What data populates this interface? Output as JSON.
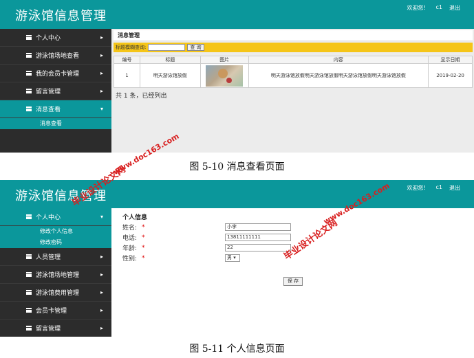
{
  "colors": {
    "teal": "#0b979b",
    "sidebar": "#2c2c2c",
    "search_bar": "#f5c518",
    "watermark": "#d81e1e"
  },
  "screen1": {
    "app_title": "游泳馆信息管理",
    "top_right": {
      "welcome": "欢迎您！",
      "user": "c1",
      "logout": "退出"
    },
    "sidebar": {
      "items": [
        {
          "label": "个人中心",
          "icon": "list-icon",
          "arrow": "▸"
        },
        {
          "label": "游泳馆场地查看",
          "icon": "list-icon",
          "arrow": "▸"
        },
        {
          "label": "我的会员卡管理",
          "icon": "list-icon",
          "arrow": "▸"
        },
        {
          "label": "留言管理",
          "icon": "list-icon",
          "arrow": "▸"
        },
        {
          "label": "消息查看",
          "icon": "list-icon",
          "arrow": "▾"
        }
      ],
      "sub_items": [
        "消息查看"
      ]
    },
    "breadcrumb": "消息管理",
    "search": {
      "label": "标题模糊查询:",
      "value": "",
      "button": "查 询"
    },
    "table": {
      "headers": [
        "编号",
        "标题",
        "图片",
        "内容",
        "显示日期"
      ],
      "rows": [
        {
          "id": "1",
          "title": "明天游泳馆放假",
          "image": "teddy-bear-photo",
          "content": "明天游泳馆放假明天游泳馆放假明天游泳馆放假明天游泳馆放假",
          "date": "2019-02-20"
        }
      ]
    },
    "count_text": "共 1 条，已经列出"
  },
  "caption1": "图 5-10 消息查看页面",
  "screen2": {
    "app_title": "游泳馆信息管理",
    "top_right": {
      "welcome": "欢迎您！",
      "user": "c1",
      "logout": "退出"
    },
    "sidebar": {
      "items": [
        {
          "label": "个人中心",
          "icon": "list-icon",
          "arrow": "▾"
        },
        {
          "label": "人员管理",
          "icon": "list-icon",
          "arrow": "▸"
        },
        {
          "label": "游泳馆场地管理",
          "icon": "list-icon",
          "arrow": "▸"
        },
        {
          "label": "游泳馆费用管理",
          "icon": "list-icon",
          "arrow": "▸"
        },
        {
          "label": "会员卡管理",
          "icon": "list-icon",
          "arrow": "▸"
        },
        {
          "label": "留言管理",
          "icon": "list-icon",
          "arrow": "▸"
        }
      ],
      "sub_items": [
        "修改个人信息",
        "修改密码"
      ]
    },
    "form": {
      "title": "个人信息",
      "fields": [
        {
          "label": "姓名:",
          "required": "*",
          "value": "小李"
        },
        {
          "label": "电话:",
          "required": "*",
          "value": "13811111111"
        },
        {
          "label": "年龄:",
          "required": "*",
          "value": "22"
        },
        {
          "label": "性别:",
          "required": "*",
          "value": "男 ▾"
        }
      ],
      "save": "保 存"
    }
  },
  "caption2": "图 5-11 个人信息页面",
  "watermarks": [
    "毕业设计论文网",
    "www.doc163.com"
  ]
}
